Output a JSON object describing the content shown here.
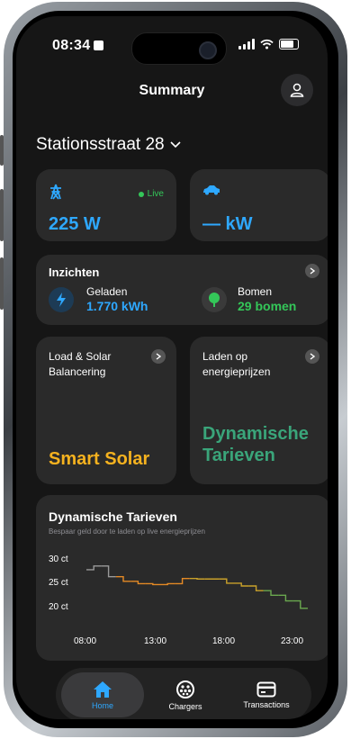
{
  "status": {
    "time": "08:34"
  },
  "header": {
    "title": "Summary"
  },
  "location": {
    "name": "Stationsstraat 28"
  },
  "grid_card": {
    "live_label": "Live",
    "value": "225 W"
  },
  "car_card": {
    "value": "— kW"
  },
  "insights": {
    "title": "Inzichten",
    "charged_label": "Geladen",
    "charged_value": "1.770 kWh",
    "trees_label": "Bomen",
    "trees_value": "29 bomen"
  },
  "smart_solar": {
    "label": "Load & Solar Balancering",
    "big": "Smart Solar"
  },
  "dynamic": {
    "label": "Laden op energieprijzen",
    "big": "Dynamische Tarieven"
  },
  "tariffs": {
    "title": "Dynamische Tarieven",
    "subtitle": "Bespaar geld door te laden op live energieprijzen",
    "y_labels": [
      "30 ct",
      "25 ct",
      "20 ct"
    ],
    "x_labels": [
      "08:00",
      "13:00",
      "18:00",
      "23:00"
    ]
  },
  "tabs": [
    {
      "label": "Home",
      "icon": "home-icon"
    },
    {
      "label": "Chargers",
      "icon": "charger-connector-icon"
    },
    {
      "label": "Transactions",
      "icon": "card-icon"
    }
  ],
  "colors": {
    "accent_blue": "#2ea8ff",
    "green": "#34c759",
    "solar_yellow": "#f5b21f",
    "tariff_green": "#3aa57a",
    "orange": "#e58a25"
  },
  "chart_data": {
    "type": "line",
    "x": [
      "08:00",
      "09:00",
      "10:00",
      "11:00",
      "12:00",
      "13:00",
      "14:00",
      "15:00",
      "16:00",
      "17:00",
      "18:00",
      "19:00",
      "20:00",
      "21:00",
      "22:00",
      "23:00"
    ],
    "series": [
      {
        "values": [
          27.5,
          28.3,
          26.0,
          25.0,
          24.5,
          24.3,
          24.5,
          25.6,
          25.5,
          25.5,
          24.6,
          24.0,
          23.0,
          22.0,
          20.8,
          19.2
        ]
      }
    ],
    "ylim": [
      18,
      30
    ],
    "xlabel": "",
    "ylabel": ""
  }
}
